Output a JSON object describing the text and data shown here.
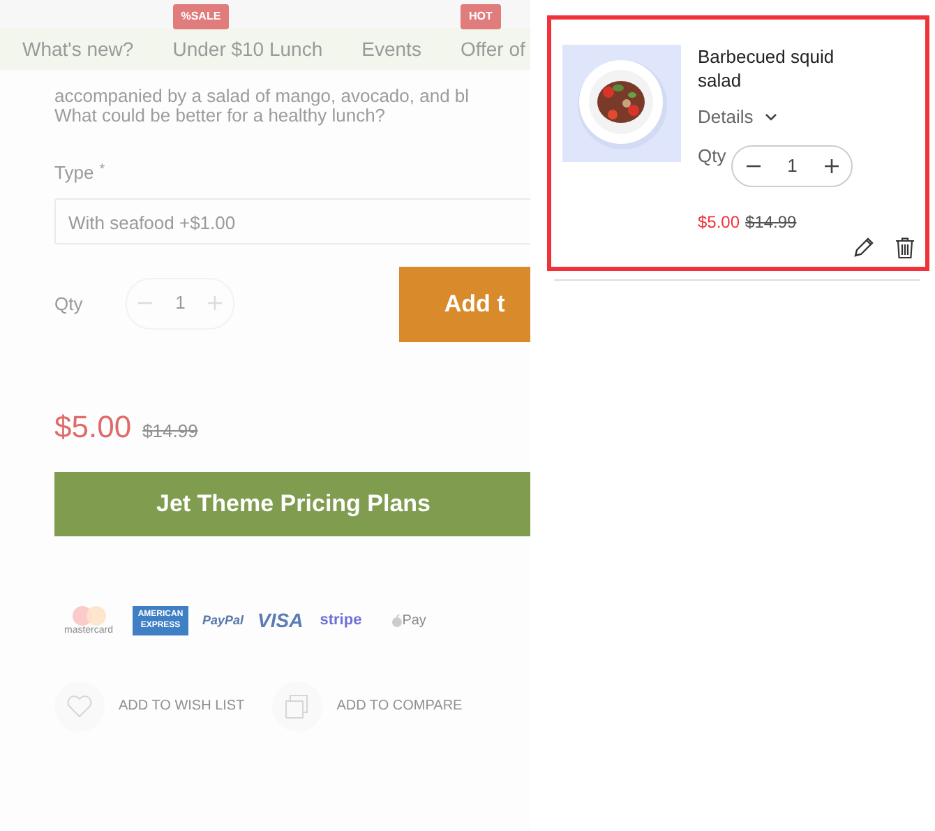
{
  "nav": {
    "items": [
      {
        "label": "What's new?"
      },
      {
        "label": "Under $10 Lunch",
        "badge": "%SALE"
      },
      {
        "label": "Events"
      },
      {
        "label": "Offer of",
        "badge": "HOT"
      }
    ]
  },
  "product": {
    "description": [
      "accompanied by a salad of mango, avocado, and bl",
      "What could be better for a healthy lunch?"
    ],
    "type_label": "Type",
    "type_mark": "*",
    "type_value": "With seafood +$1.00",
    "qty_label": "Qty",
    "qty": "1",
    "add_button": "Add t",
    "price": "$5.00",
    "old_price": "$14.99",
    "pricing_button": "Jet Theme Pricing Plans",
    "payments": [
      {
        "kind": "mastercard",
        "text": "mastercard"
      },
      {
        "kind": "amex",
        "text": "AMERICAN EXPRESS"
      },
      {
        "kind": "paypal",
        "text": "PayPal"
      },
      {
        "kind": "visa",
        "text": "VISA"
      },
      {
        "kind": "stripe",
        "text": "stripe"
      },
      {
        "kind": "applepay",
        "text": "Pay"
      }
    ],
    "actions": [
      {
        "kind": "wishlist",
        "label": "ADD TO WISH LIST"
      },
      {
        "kind": "compare",
        "label": "ADD TO COMPARE"
      }
    ]
  },
  "cart": {
    "items": [
      {
        "name": "Barbecued squid salad",
        "details": "Details",
        "qty_label": "Qty",
        "qty": "1",
        "price": "$5.00",
        "old_price": "$14.99",
        "highlighted": true
      }
    ]
  }
}
